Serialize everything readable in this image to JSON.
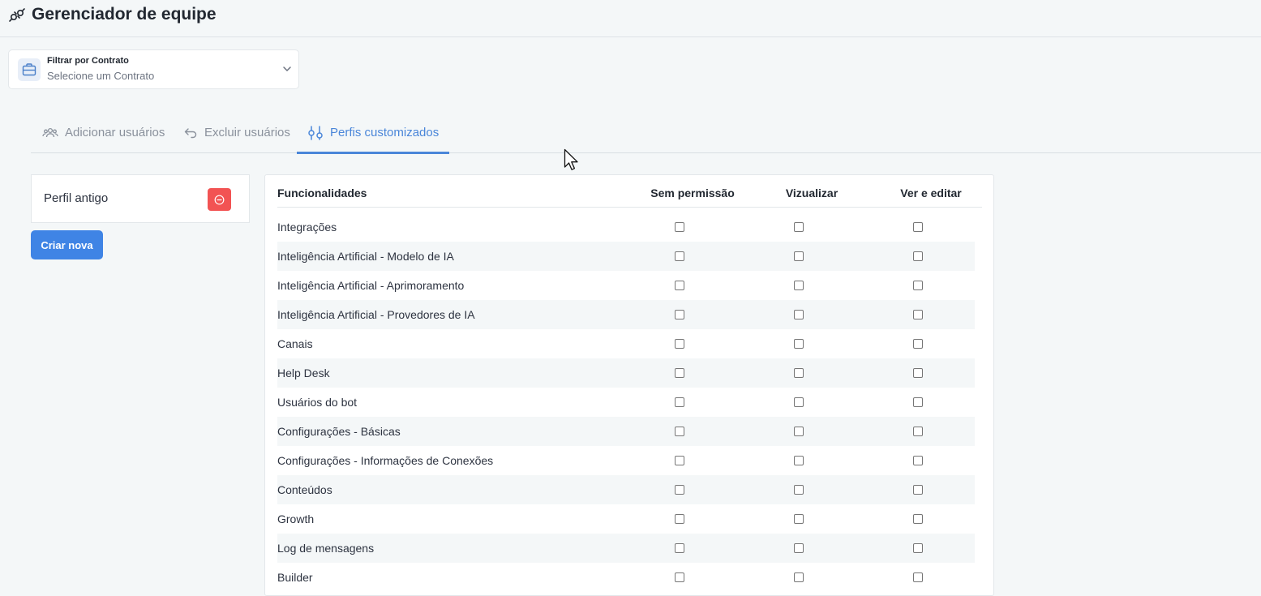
{
  "header": {
    "title": "Gerenciador de equipe",
    "logo_icon": "plug-icon"
  },
  "contract_filter": {
    "label": "Filtrar por Contrato",
    "placeholder": "Selecione um Contrato",
    "icon": "briefcase-icon"
  },
  "tabs": [
    {
      "label": "Adicionar usuários",
      "icon": "users-icon",
      "active": false
    },
    {
      "label": "Excluir usuários",
      "icon": "undo-arrow-icon",
      "active": false
    },
    {
      "label": "Perfis customizados",
      "icon": "sliders-icon",
      "active": true
    }
  ],
  "profiles": [
    {
      "name": "Perfil antigo"
    }
  ],
  "create_button": "Criar nova",
  "permissions": {
    "columns": [
      "Funcionalidades",
      "Sem permissão",
      "Vizualizar",
      "Ver e editar"
    ],
    "rows": [
      "Integrações",
      "Inteligência Artificial - Modelo de IA",
      "Inteligência Artificial - Aprimoramento",
      "Inteligência Artificial - Provedores de IA",
      "Canais",
      "Help Desk",
      "Usuários do bot",
      "Configurações - Básicas",
      "Configurações - Informações de Conexões",
      "Conteúdos",
      "Growth",
      "Log de mensagens",
      "Builder"
    ]
  },
  "colors": {
    "accent": "#4a86d9",
    "button": "#3f84e5",
    "danger": "#f25353",
    "background": "#f4f7f8"
  }
}
